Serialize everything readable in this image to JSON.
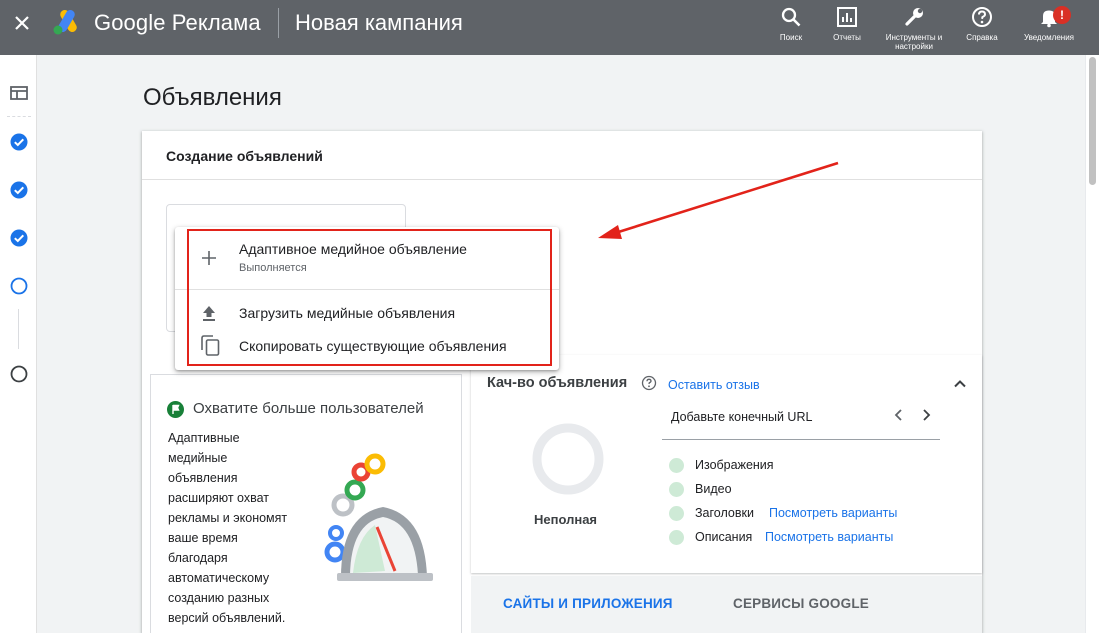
{
  "header": {
    "brand": "Google Реклама",
    "campaign": "Новая кампания",
    "tools": [
      {
        "label": "Поиск",
        "icon": "search-icon"
      },
      {
        "label": "Отчеты",
        "icon": "reports-icon"
      },
      {
        "label": "Инструменты и настройки",
        "icon": "wrench-icon"
      },
      {
        "label": "Справка",
        "icon": "help-icon"
      },
      {
        "label": "Уведомления",
        "icon": "bell-icon"
      }
    ],
    "notification_badge": "!"
  },
  "page": {
    "title": "Объявления"
  },
  "card": {
    "title": "Создание объявлений"
  },
  "menu": {
    "items": [
      {
        "label": "Адаптивное медийное объявление",
        "sub": "Выполняется",
        "icon": "plus-icon"
      },
      {
        "label": "Загрузить медийные объявления",
        "icon": "upload-icon"
      },
      {
        "label": "Скопировать существующие объявления",
        "icon": "copy-icon"
      }
    ]
  },
  "promo": {
    "title": "Охватите больше пользователей",
    "text_lines": [
      "Адаптивные",
      "медийные",
      "объявления",
      "расширяют охват",
      "рекламы и экономят",
      "ваше время",
      "благодаря",
      "автоматическому",
      "созданию разных",
      "версий объявлений."
    ]
  },
  "quality": {
    "title": "Кач-во объявления",
    "feedback_link": "Оставить отзыв",
    "url_prompt": "Добавьте конечный URL",
    "status": "Неполная",
    "checks": [
      {
        "label": "Изображения",
        "link": ""
      },
      {
        "label": "Видео",
        "link": ""
      },
      {
        "label": "Заголовки",
        "link": "Посмотреть варианты"
      },
      {
        "label": "Описания",
        "link": "Посмотреть варианты"
      }
    ]
  },
  "tabs": [
    "САЙТЫ И ПРИЛОЖЕНИЯ",
    "СЕРВИСЫ GOOGLE"
  ],
  "colors": {
    "topbar": "#5f6368",
    "accent_blue": "#1a73e8",
    "highlight_red": "#e2231a",
    "check_green": "#ceead6"
  }
}
